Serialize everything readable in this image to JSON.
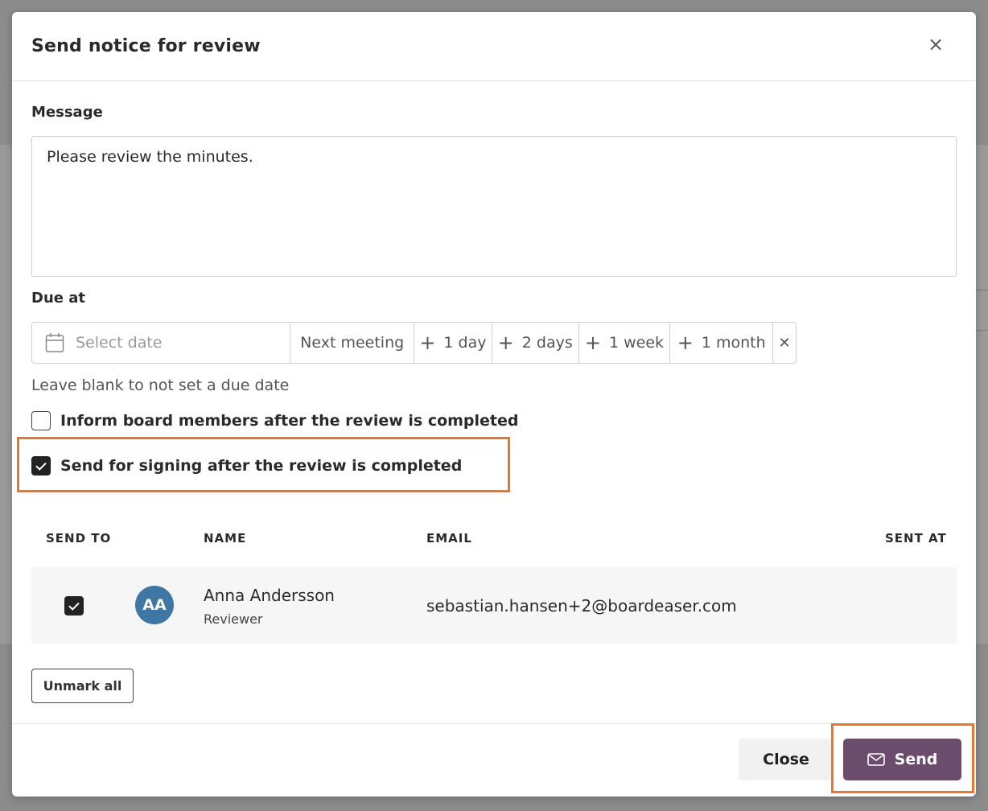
{
  "modal": {
    "title": "Send notice for review",
    "close_symbol": "×"
  },
  "message": {
    "label": "Message",
    "value": "Please review the minutes."
  },
  "due": {
    "label": "Due at",
    "date_placeholder": "Select date",
    "quick_options": [
      {
        "label": "Next meeting",
        "has_plus": false
      },
      {
        "label": "1 day",
        "has_plus": true
      },
      {
        "label": "2 days",
        "has_plus": true
      },
      {
        "label": "1 week",
        "has_plus": true
      },
      {
        "label": "1 month",
        "has_plus": true
      }
    ],
    "clear_symbol": "✕",
    "hint": "Leave blank to not set a due date"
  },
  "options": {
    "inform_label": "Inform board members after the review is completed",
    "inform_checked": false,
    "signing_label": "Send for signing after the review is completed",
    "signing_checked": true
  },
  "table": {
    "headers": {
      "send_to": "SEND TO",
      "name": "NAME",
      "email": "EMAIL",
      "sent_at": "SENT AT"
    },
    "rows": [
      {
        "checked": true,
        "initials": "AA",
        "name": "Anna Andersson",
        "role": "Reviewer",
        "email": "sebastian.hansen+2@boardeaser.com",
        "sent_at": ""
      }
    ]
  },
  "buttons": {
    "unmark_all": "Unmark all",
    "close": "Close",
    "send": "Send"
  },
  "colors": {
    "accent_send": "#6b4c6c",
    "highlight": "#e8762d",
    "avatar": "#3e76a4"
  },
  "icons": {
    "calendar": "calendar-icon",
    "mail": "mail-icon",
    "plus": "plus-icon",
    "close": "close-icon"
  }
}
